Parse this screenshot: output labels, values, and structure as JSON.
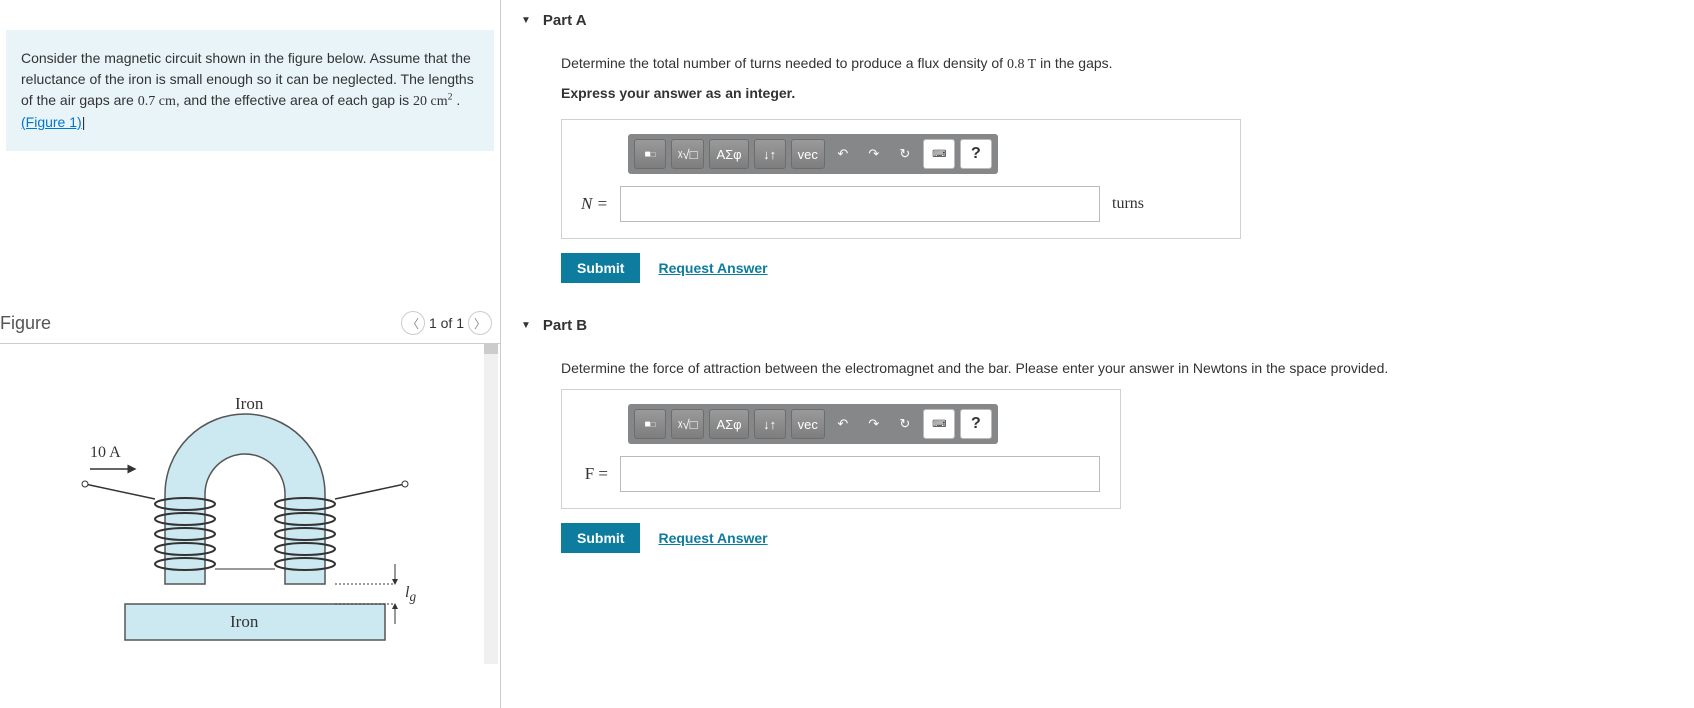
{
  "instructions": {
    "t1": "Consider the magnetic circuit shown in the figure below. Assume that the reluctance of the iron is small enough so it can be neglected. The lengths of the air gaps are ",
    "gap_len": "0.7 cm",
    "t2": ", and the effective area of each gap is ",
    "gap_area": "20 cm",
    "gap_area_exp": "2",
    "t3": " .",
    "figure_link": "(Figure 1)"
  },
  "figure": {
    "title": "Figure",
    "pager": "1 of 1",
    "labels": {
      "iron_top": "Iron",
      "iron_bar": "Iron",
      "current": "10 A",
      "gap": "l",
      "gap_sub": "g"
    }
  },
  "parts": {
    "a": {
      "title": "Part A",
      "question": "Determine the total number of turns needed to produce a flux density of ",
      "flux": "0.8 T",
      "question2": " in the gaps.",
      "sub": "Express your answer as an integer.",
      "prefix": "N =",
      "suffix": "turns"
    },
    "b": {
      "title": "Part B",
      "question": "Determine the force of attraction between the electromagnet and the bar. Please enter your answer in Newtons in the space provided.",
      "prefix": "F ="
    }
  },
  "toolbar": {
    "templates": "■",
    "root": "ᵡ√□",
    "greek": "ΑΣφ",
    "subsup": "↓↑",
    "vec": "vec",
    "undo": "↶",
    "redo": "↷",
    "reset": "↻",
    "keyboard": "⌨",
    "help": "?"
  },
  "actions": {
    "submit": "Submit",
    "request": "Request Answer"
  }
}
